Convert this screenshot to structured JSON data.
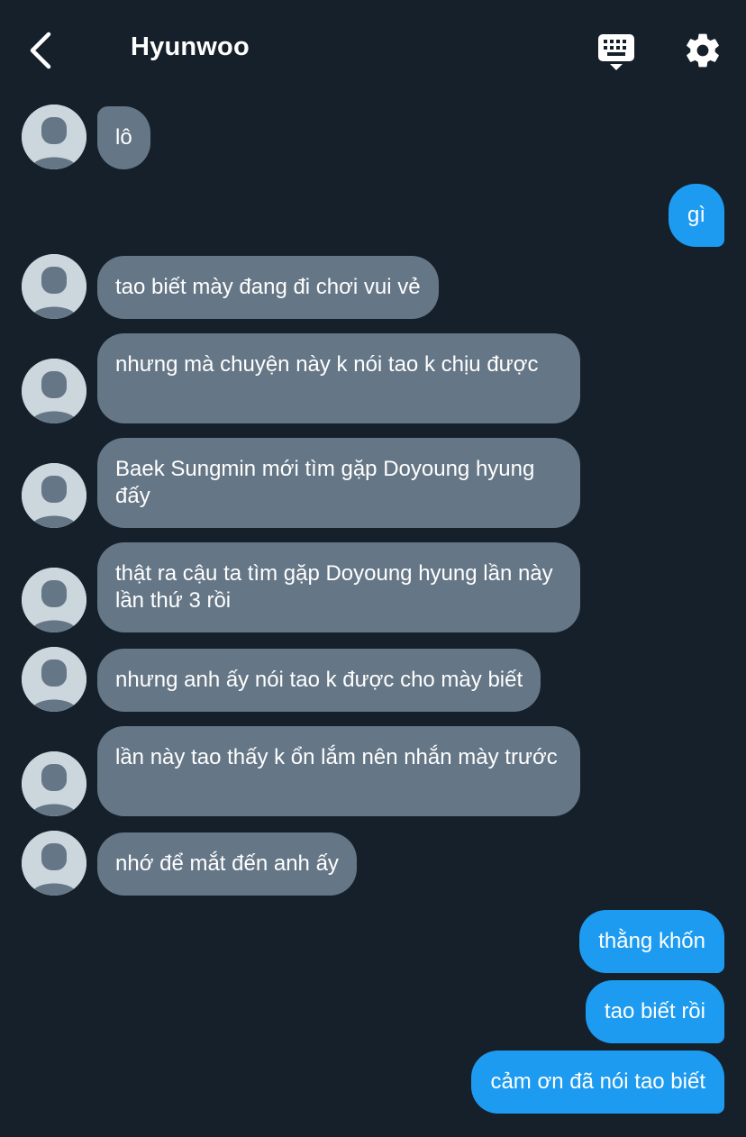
{
  "header": {
    "title": "Hyunwoo",
    "back_icon": "chevron-left-icon",
    "keyboard_icon": "keyboard-icon",
    "settings_icon": "gear-icon"
  },
  "colors": {
    "background": "#16202b",
    "incoming_bubble": "#657686",
    "outgoing_bubble": "#1d9bf0",
    "avatar": "#ccd6dd"
  },
  "messages": [
    {
      "from": "them",
      "text": "lô"
    },
    {
      "from": "me",
      "text": "gì"
    },
    {
      "from": "them",
      "text": "tao biết mày đang đi chơi vui vẻ"
    },
    {
      "from": "them",
      "text": "nhưng mà chuyện này k nói tao k chịu được"
    },
    {
      "from": "them",
      "text": "Baek Sungmin mới tìm gặp Doyoung hyung đấy"
    },
    {
      "from": "them",
      "text": "thật ra cậu ta tìm gặp Doyoung hyung lần này lần thứ 3 rồi"
    },
    {
      "from": "them",
      "text": "nhưng anh ấy nói tao k được cho mày biết"
    },
    {
      "from": "them",
      "text": "lần này tao thấy k ổn lắm nên nhắn mày trước"
    },
    {
      "from": "them",
      "text": "nhớ để mắt đến anh ấy"
    },
    {
      "from": "me",
      "text": "thằng khốn"
    },
    {
      "from": "me",
      "text": "tao biết rồi"
    },
    {
      "from": "me",
      "text": "cảm ơn đã nói tao biết"
    }
  ]
}
